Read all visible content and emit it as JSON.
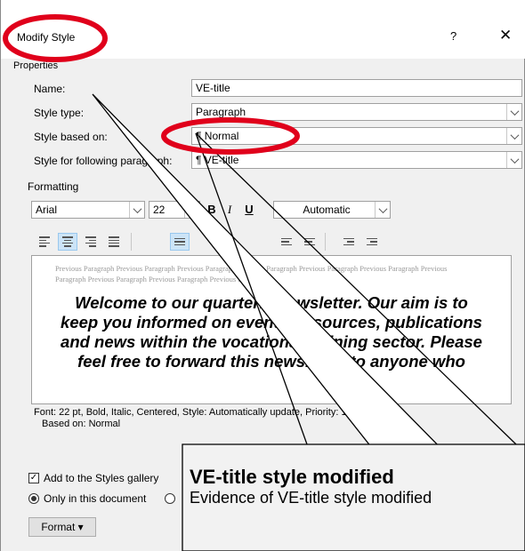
{
  "dialog": {
    "title": "Modify Style",
    "help": "?",
    "close": "✕"
  },
  "properties": {
    "section": "Properties",
    "name_label": "Name:",
    "name_value": "VE-title",
    "type_label": "Style type:",
    "type_value": "Paragraph",
    "based_label": "Style based on:",
    "based_value": "¶  Normal",
    "following_label": "Style for following paragraph:",
    "following_value": "¶  VE-title"
  },
  "formatting": {
    "section": "Formatting",
    "font": "Arial",
    "size": "22",
    "bold": "B",
    "italic": "I",
    "underline": "U",
    "color": "Automatic"
  },
  "preview": {
    "previous": "Previous Paragraph Previous Paragraph Previous Paragraph Previous Paragraph Previous Paragraph Previous Paragraph Previous Paragraph Previous Paragraph Previous Paragraph Previous Paragraph",
    "text": "Welcome to our quarterly newsletter. Our aim is to keep you informed on events, resources, publications and news within the vocational training sector. Please feel free to forward this newsletter to anyone who"
  },
  "description": {
    "line1": "Font: 22 pt, Bold, Italic, Centered, Style: Automatically update, Priority: 1",
    "line2": "Based on: Normal"
  },
  "options": {
    "add_gallery": "Add to the Styles gallery",
    "only_doc": "Only in this document"
  },
  "buttons": {
    "format": "Format ▾"
  },
  "callout": {
    "title": "VE-title style modified",
    "subtitle": "Evidence of VE-title style modified"
  },
  "colors": {
    "highlight": "#e0001b",
    "active": "#cce4f7"
  }
}
